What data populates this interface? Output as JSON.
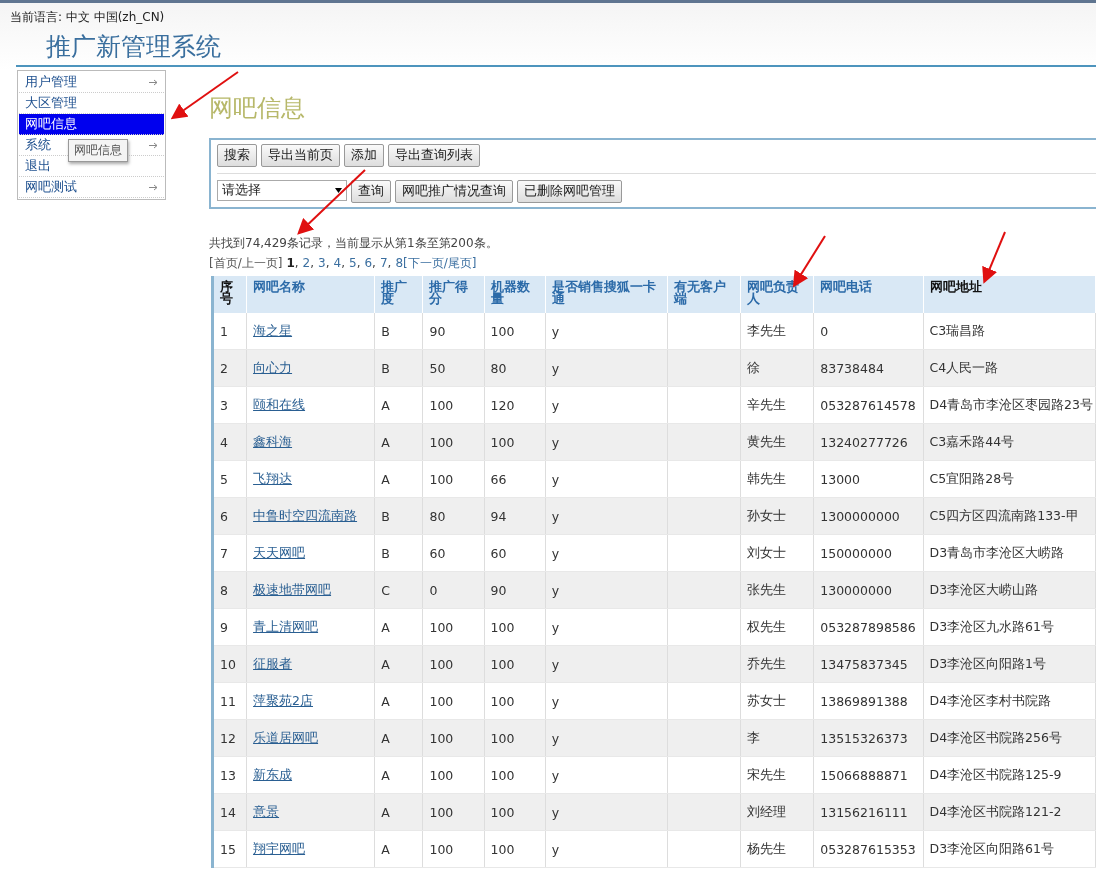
{
  "language_bar": "当前语言: 中文 中国(zh_CN)",
  "app_title": "推广新管理系统",
  "sidebar": {
    "items": [
      {
        "label": "用户管理",
        "selected": false,
        "has_submenu": true
      },
      {
        "label": "大区管理",
        "selected": false,
        "has_submenu": false
      },
      {
        "label": "网吧信息",
        "selected": true,
        "has_submenu": false
      },
      {
        "label": "系统",
        "selected": false,
        "has_submenu": true
      },
      {
        "label": "退出",
        "selected": false,
        "has_submenu": false
      },
      {
        "label": "网吧测试",
        "selected": false,
        "has_submenu": true
      }
    ],
    "tooltip": "网吧信息"
  },
  "page_title": "网吧信息",
  "toolbar": {
    "buttons": [
      "搜索",
      "导出当前页",
      "添加",
      "导出查询列表"
    ],
    "select": {
      "value": "请选择"
    },
    "query_buttons": [
      "查询",
      "网吧推广情况查询",
      "已删除网吧管理"
    ]
  },
  "summary": "共找到74,429条记录，当前显示从第1条至第200条。",
  "pagination": {
    "first_prev": "[首页/上一页]",
    "pages": [
      {
        "label": "1",
        "selected": true
      },
      {
        "label": "2",
        "selected": false
      },
      {
        "label": "3",
        "selected": false
      },
      {
        "label": "4",
        "selected": false
      },
      {
        "label": "5",
        "selected": false
      },
      {
        "label": "6",
        "selected": false
      },
      {
        "label": "7",
        "selected": false
      },
      {
        "label": "8",
        "selected": false
      }
    ],
    "separator": ",",
    "next": "[下一页/尾页]"
  },
  "table": {
    "columns": [
      "序号",
      "网吧名称",
      "推广度",
      "推广得分",
      "机器数量",
      "是否销售搜狐一卡通",
      "有无客户端",
      "网吧负责人",
      "网吧电话",
      "网吧地址"
    ],
    "rows": [
      [
        "1",
        "海之星",
        "B",
        "90",
        "100",
        "y",
        "",
        "李先生",
        "0",
        "C3瑞昌路"
      ],
      [
        "2",
        "向心力",
        "B",
        "50",
        "80",
        "y",
        "",
        "徐",
        "83738484",
        "C4人民一路"
      ],
      [
        "3",
        "颐和在线",
        "A",
        "100",
        "120",
        "y",
        "",
        "辛先生",
        "053287614578",
        "D4青岛市李沧区枣园路23号"
      ],
      [
        "4",
        "鑫科海",
        "A",
        "100",
        "100",
        "y",
        "",
        "黄先生",
        "13240277726",
        "C3嘉禾路44号"
      ],
      [
        "5",
        "飞翔达",
        "A",
        "100",
        "66",
        "y",
        "",
        "韩先生",
        "13000",
        "C5宜阳路28号"
      ],
      [
        "6",
        "中鲁时空四流南路",
        "B",
        "80",
        "94",
        "y",
        "",
        "孙女士",
        "1300000000",
        "C5四方区四流南路133-甲"
      ],
      [
        "7",
        "天天网吧",
        "B",
        "60",
        "60",
        "y",
        "",
        "刘女士",
        "150000000",
        "D3青岛市李沧区大崂路"
      ],
      [
        "8",
        "极速地带网吧",
        "C",
        "0",
        "90",
        "y",
        "",
        "张先生",
        "130000000",
        "D3李沧区大崂山路"
      ],
      [
        "9",
        "青上清网吧",
        "A",
        "100",
        "100",
        "y",
        "",
        "权先生",
        "053287898586",
        "D3李沧区九水路61号"
      ],
      [
        "10",
        "征服者",
        "A",
        "100",
        "100",
        "y",
        "",
        "乔先生",
        "13475837345",
        "D3李沧区向阳路1号"
      ],
      [
        "11",
        "萍聚苑2店",
        "A",
        "100",
        "100",
        "y",
        "",
        "苏女士",
        "13869891388",
        "D4李沧区李村书院路"
      ],
      [
        "12",
        "乐道居网吧",
        "A",
        "100",
        "100",
        "y",
        "",
        "李",
        "13515326373",
        "D4李沧区书院路256号"
      ],
      [
        "13",
        "新东成",
        "A",
        "100",
        "100",
        "y",
        "",
        "宋先生",
        "15066888871",
        "D4李沧区书院路125-9"
      ],
      [
        "14",
        "意景",
        "A",
        "100",
        "100",
        "y",
        "",
        "刘经理",
        "13156216111",
        "D4李沧区书院路121-2"
      ],
      [
        "15",
        "翔宇网吧",
        "A",
        "100",
        "100",
        "y",
        "",
        "杨先生",
        "053287615353",
        "D3李沧区向阳路61号"
      ]
    ]
  }
}
